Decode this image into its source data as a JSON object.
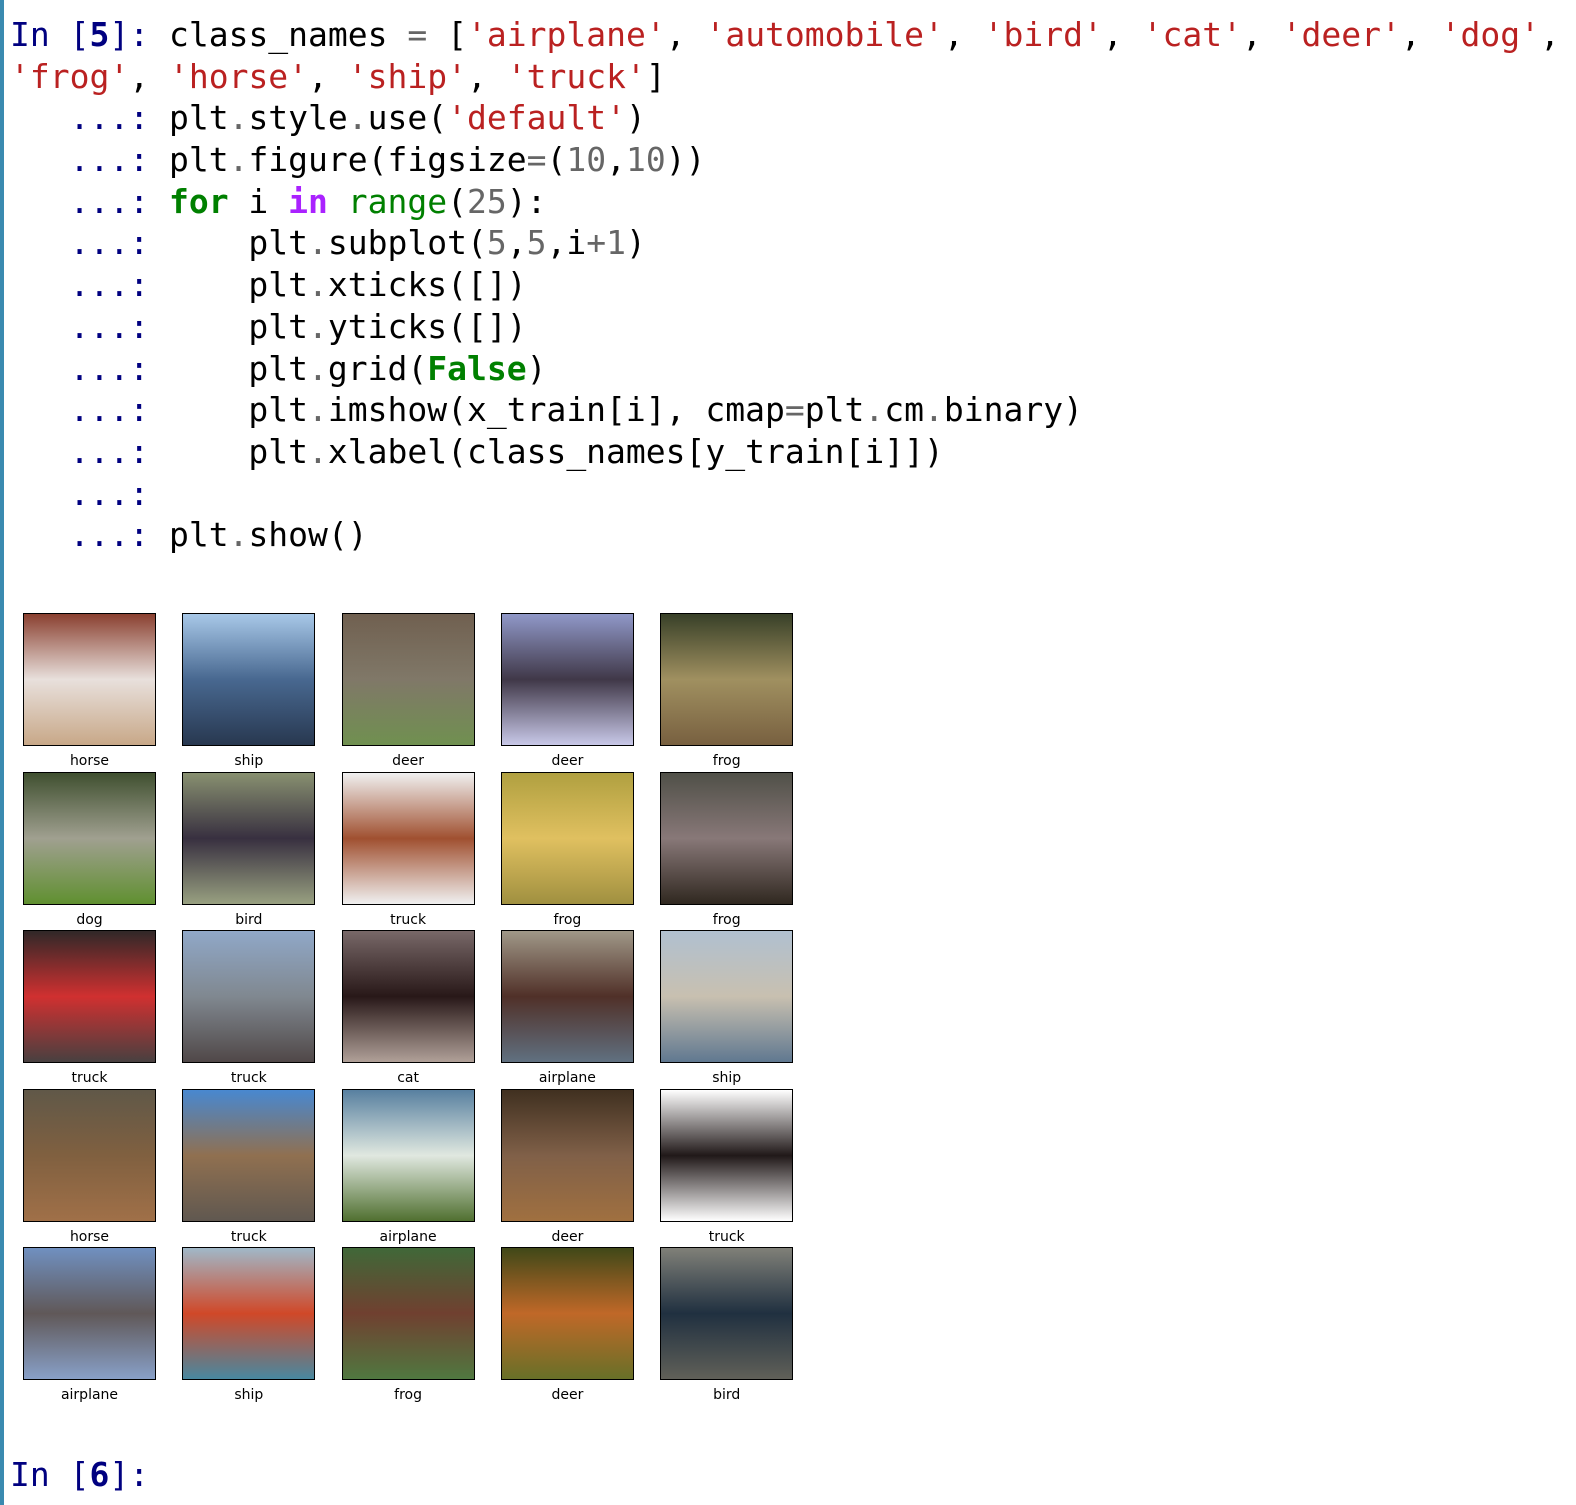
{
  "code_cell": {
    "lines": [
      [
        [
          "In [",
          "prompt"
        ],
        [
          "5",
          "pnum"
        ],
        [
          "]: ",
          "prompt"
        ],
        [
          "class_names ",
          ""
        ],
        [
          "=",
          "op"
        ],
        [
          " [",
          ""
        ],
        [
          "'airplane'",
          "str"
        ],
        [
          ", ",
          ""
        ],
        [
          "'automobile'",
          "str"
        ],
        [
          ", ",
          ""
        ],
        [
          "'bird'",
          "str"
        ],
        [
          ", ",
          ""
        ],
        [
          "'cat'",
          "str"
        ],
        [
          ", ",
          ""
        ],
        [
          "'deer'",
          "str"
        ],
        [
          ", ",
          ""
        ],
        [
          "'dog'",
          "str"
        ],
        [
          ",",
          ""
        ]
      ],
      [
        [
          "'frog'",
          "str"
        ],
        [
          ", ",
          ""
        ],
        [
          "'horse'",
          "str"
        ],
        [
          ", ",
          ""
        ],
        [
          "'ship'",
          "str"
        ],
        [
          ", ",
          ""
        ],
        [
          "'truck'",
          "str"
        ],
        [
          "]",
          ""
        ]
      ],
      [
        [
          "   ...: ",
          "cont"
        ],
        [
          "plt",
          ""
        ],
        [
          ".",
          "op"
        ],
        [
          "style",
          ""
        ],
        [
          ".",
          "op"
        ],
        [
          "use(",
          ""
        ],
        [
          "'default'",
          "str"
        ],
        [
          ")",
          ""
        ]
      ],
      [
        [
          "   ...: ",
          "cont"
        ],
        [
          "plt",
          ""
        ],
        [
          ".",
          "op"
        ],
        [
          "figure(figsize",
          ""
        ],
        [
          "=",
          "op"
        ],
        [
          "(",
          ""
        ],
        [
          "10",
          "num"
        ],
        [
          ",",
          ""
        ],
        [
          "10",
          "num"
        ],
        [
          "))",
          ""
        ]
      ],
      [
        [
          "   ...: ",
          "cont"
        ],
        [
          "for",
          "kw"
        ],
        [
          " i ",
          ""
        ],
        [
          "in",
          "in"
        ],
        [
          " ",
          ""
        ],
        [
          "range",
          "bi"
        ],
        [
          "(",
          ""
        ],
        [
          "25",
          "num"
        ],
        [
          "):",
          ""
        ]
      ],
      [
        [
          "   ...:     ",
          "cont"
        ],
        [
          "plt",
          ""
        ],
        [
          ".",
          "op"
        ],
        [
          "subplot(",
          ""
        ],
        [
          "5",
          "num"
        ],
        [
          ",",
          ""
        ],
        [
          "5",
          "num"
        ],
        [
          ",i",
          ""
        ],
        [
          "+",
          "op"
        ],
        [
          "1",
          "num"
        ],
        [
          ")",
          ""
        ]
      ],
      [
        [
          "   ...:     ",
          "cont"
        ],
        [
          "plt",
          ""
        ],
        [
          ".",
          "op"
        ],
        [
          "xticks([])",
          ""
        ]
      ],
      [
        [
          "   ...:     ",
          "cont"
        ],
        [
          "plt",
          ""
        ],
        [
          ".",
          "op"
        ],
        [
          "yticks([])",
          ""
        ]
      ],
      [
        [
          "   ...:     ",
          "cont"
        ],
        [
          "plt",
          ""
        ],
        [
          ".",
          "op"
        ],
        [
          "grid(",
          ""
        ],
        [
          "False",
          "kw"
        ],
        [
          ")",
          ""
        ]
      ],
      [
        [
          "   ...:     ",
          "cont"
        ],
        [
          "plt",
          ""
        ],
        [
          ".",
          "op"
        ],
        [
          "imshow(x_train[i], cmap",
          ""
        ],
        [
          "=",
          "op"
        ],
        [
          "plt",
          ""
        ],
        [
          ".",
          "op"
        ],
        [
          "cm",
          ""
        ],
        [
          ".",
          "op"
        ],
        [
          "binary)",
          ""
        ]
      ],
      [
        [
          "   ...:     ",
          "cont"
        ],
        [
          "plt",
          ""
        ],
        [
          ".",
          "op"
        ],
        [
          "xlabel(class_names[y_train[i]])",
          ""
        ]
      ],
      [
        [
          "   ...: ",
          "cont"
        ]
      ],
      [
        [
          "   ...: ",
          "cont"
        ],
        [
          "plt",
          ""
        ],
        [
          ".",
          "op"
        ],
        [
          "show()",
          ""
        ]
      ]
    ]
  },
  "figure": {
    "subplots": [
      {
        "label": "horse",
        "colors": [
          "#8a4030",
          "#e8e0dc",
          "#c8a888"
        ]
      },
      {
        "label": "ship",
        "colors": [
          "#a8c8e8",
          "#486890",
          "#283850"
        ]
      },
      {
        "label": "deer",
        "colors": [
          "#706050",
          "#807868",
          "#709050"
        ]
      },
      {
        "label": "deer",
        "colors": [
          "#9098c8",
          "#403848",
          "#c8c8e8"
        ]
      },
      {
        "label": "frog",
        "colors": [
          "#384028",
          "#a09060",
          "#786040"
        ]
      },
      {
        "label": "dog",
        "colors": [
          "#405030",
          "#a0a090",
          "#609030"
        ]
      },
      {
        "label": "bird",
        "colors": [
          "#889070",
          "#383040",
          "#98a080"
        ]
      },
      {
        "label": "truck",
        "colors": [
          "#f0f0f0",
          "#a05030",
          "#f0f0f0"
        ]
      },
      {
        "label": "frog",
        "colors": [
          "#b0a040",
          "#e0c060",
          "#a09040"
        ]
      },
      {
        "label": "frog",
        "colors": [
          "#505048",
          "#887878",
          "#302820"
        ]
      },
      {
        "label": "truck",
        "colors": [
          "#302828",
          "#d03030",
          "#484040"
        ]
      },
      {
        "label": "truck",
        "colors": [
          "#90a8c8",
          "#808890",
          "#504848"
        ]
      },
      {
        "label": "cat",
        "colors": [
          "#786868",
          "#281818",
          "#b0a098"
        ]
      },
      {
        "label": "airplane",
        "colors": [
          "#a09888",
          "#503028",
          "#607080"
        ]
      },
      {
        "label": "ship",
        "colors": [
          "#b0c0d0",
          "#c8c0b0",
          "#607890"
        ]
      },
      {
        "label": "horse",
        "colors": [
          "#605848",
          "#806040",
          "#a07048"
        ]
      },
      {
        "label": "truck",
        "colors": [
          "#4888d0",
          "#907050",
          "#605850"
        ]
      },
      {
        "label": "airplane",
        "colors": [
          "#5880a0",
          "#e0e8e0",
          "#507030"
        ]
      },
      {
        "label": "deer",
        "colors": [
          "#403020",
          "#806048",
          "#a07040"
        ]
      },
      {
        "label": "truck",
        "colors": [
          "#ffffff",
          "#201818",
          "#ffffff"
        ]
      },
      {
        "label": "airplane",
        "colors": [
          "#7090c0",
          "#605858",
          "#88a0c8"
        ]
      },
      {
        "label": "ship",
        "colors": [
          "#a0b8c8",
          "#d04828",
          "#4888a0"
        ]
      },
      {
        "label": "frog",
        "colors": [
          "#406838",
          "#704030",
          "#507840"
        ]
      },
      {
        "label": "deer",
        "colors": [
          "#404818",
          "#c06828",
          "#687028"
        ]
      },
      {
        "label": "bird",
        "colors": [
          "#808078",
          "#203040",
          "#606058"
        ]
      }
    ]
  },
  "next_prompt": {
    "prefix": "In [",
    "number": "6",
    "suffix": "]: "
  }
}
